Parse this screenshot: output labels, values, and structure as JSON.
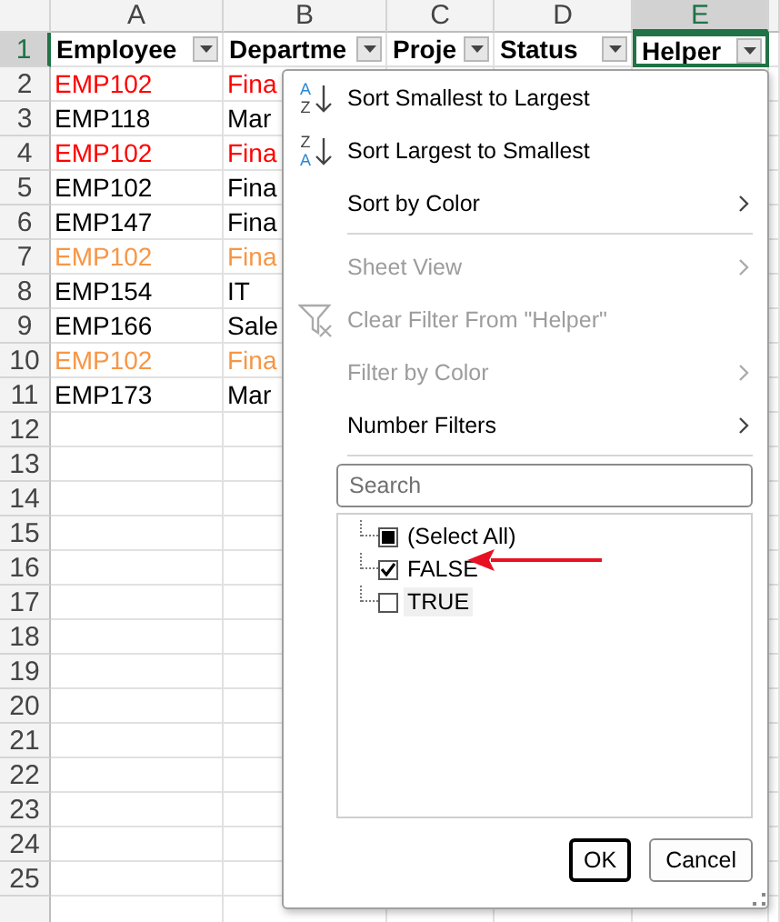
{
  "columns": [
    {
      "letter": "A",
      "selected": false
    },
    {
      "letter": "B",
      "selected": false
    },
    {
      "letter": "C",
      "selected": false
    },
    {
      "letter": "D",
      "selected": false
    },
    {
      "letter": "E",
      "selected": true
    }
  ],
  "header_row": {
    "number": "1",
    "selected": true,
    "cells": [
      {
        "text": "Employee",
        "active": false
      },
      {
        "text": "Departme",
        "active": false
      },
      {
        "text": "Proje",
        "active": false
      },
      {
        "text": "Status",
        "active": false
      },
      {
        "text": "Helper",
        "active": true
      }
    ]
  },
  "rows": [
    {
      "number": "2",
      "color": "#ff0000",
      "cells": [
        "EMP102",
        "Fina"
      ]
    },
    {
      "number": "3",
      "color": "#000000",
      "cells": [
        "EMP118",
        "Mar"
      ]
    },
    {
      "number": "4",
      "color": "#ff0000",
      "cells": [
        "EMP102",
        "Fina"
      ]
    },
    {
      "number": "5",
      "color": "#000000",
      "cells": [
        "EMP102",
        "Fina"
      ]
    },
    {
      "number": "6",
      "color": "#000000",
      "cells": [
        "EMP147",
        "Fina"
      ]
    },
    {
      "number": "7",
      "color": "#f79646",
      "cells": [
        "EMP102",
        "Fina"
      ]
    },
    {
      "number": "8",
      "color": "#000000",
      "cells": [
        "EMP154",
        "IT"
      ]
    },
    {
      "number": "9",
      "color": "#000000",
      "cells": [
        "EMP166",
        "Sale"
      ]
    },
    {
      "number": "10",
      "color": "#f79646",
      "cells": [
        "EMP102",
        "Fina"
      ]
    },
    {
      "number": "11",
      "color": "#000000",
      "cells": [
        "EMP173",
        "Mar"
      ]
    }
  ],
  "empty_rows": [
    "12",
    "13",
    "14",
    "15",
    "16",
    "17",
    "18",
    "19",
    "20",
    "21",
    "22",
    "23",
    "24",
    "25"
  ],
  "filter_menu": {
    "items": [
      {
        "kind": "sort",
        "label": "Sort Smallest to Largest",
        "icon_letters": [
          "A",
          "Z"
        ],
        "disabled": false,
        "submenu": false
      },
      {
        "kind": "sort",
        "label": "Sort Largest to Smallest",
        "icon_letters": [
          "Z",
          "A"
        ],
        "disabled": false,
        "submenu": false
      },
      {
        "kind": "item",
        "label": "Sort by Color",
        "disabled": false,
        "submenu": true
      },
      {
        "kind": "separator"
      },
      {
        "kind": "item",
        "label": "Sheet View",
        "disabled": true,
        "submenu": true
      },
      {
        "kind": "clear",
        "label": "Clear Filter From \"Helper\"",
        "disabled": true,
        "submenu": false
      },
      {
        "kind": "item",
        "label": "Filter by Color",
        "disabled": true,
        "submenu": true
      },
      {
        "kind": "item",
        "label": "Number Filters",
        "disabled": false,
        "submenu": true
      },
      {
        "kind": "separator"
      }
    ],
    "search": {
      "placeholder": "Search"
    },
    "values": [
      {
        "label": "(Select All)",
        "partial": true,
        "selected": false
      },
      {
        "label": "FALSE",
        "checked": true,
        "selected": false
      },
      {
        "label": "TRUE",
        "checked": false,
        "selected": true
      }
    ],
    "buttons": [
      {
        "label": "OK",
        "default": true
      },
      {
        "label": "Cancel",
        "default": false
      }
    ]
  }
}
